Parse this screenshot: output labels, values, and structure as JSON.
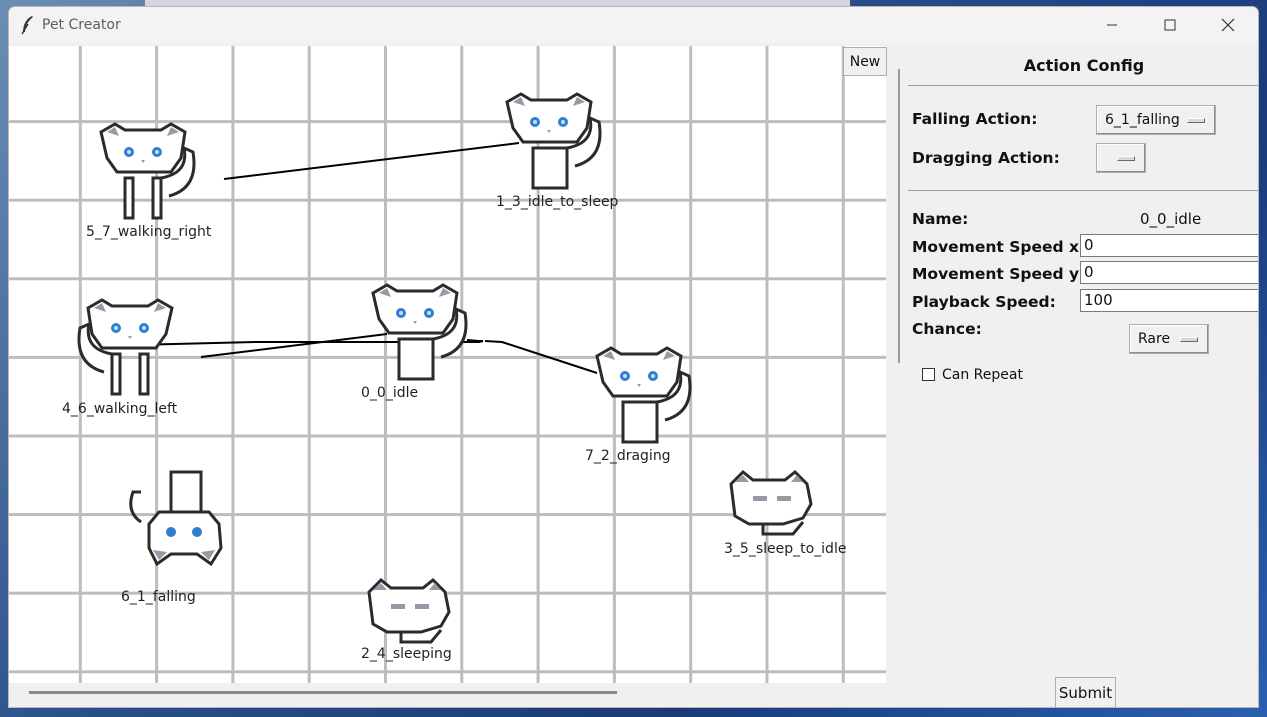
{
  "window": {
    "title": "Pet Creator"
  },
  "canvas": {
    "new_label": "New",
    "sprites": [
      {
        "id": "5_7_walking_right",
        "label": "5_7_walking_right",
        "pose": "walk-right"
      },
      {
        "id": "1_3_idle_to_sleep",
        "label": "1_3_idle_to_sleep",
        "pose": "sit"
      },
      {
        "id": "4_6_walking_left",
        "label": "4_6_walking_left",
        "pose": "walk-left"
      },
      {
        "id": "0_0_idle",
        "label": "0_0_idle",
        "pose": "sit"
      },
      {
        "id": "7_2_draging",
        "label": "7_2_draging",
        "pose": "sit"
      },
      {
        "id": "6_1_falling",
        "label": "6_1_falling",
        "pose": "fall"
      },
      {
        "id": "3_5_sleep_to_idle",
        "label": "3_5_sleep_to_idle",
        "pose": "sleep"
      },
      {
        "id": "2_4_sleeping",
        "label": "2_4_sleeping",
        "pose": "sleep"
      }
    ],
    "links": [
      {
        "from": "5_7_walking_right",
        "to": "1_3_idle_to_sleep"
      },
      {
        "from": "4_6_walking_left",
        "to": "0_0_idle"
      },
      {
        "from": "0_0_idle",
        "to": "4_6_walking_left"
      },
      {
        "from": "0_0_idle",
        "to": "7_2_draging"
      }
    ]
  },
  "panel": {
    "title": "Action Config",
    "falling_label": "Falling Action:",
    "falling_value": "6_1_falling",
    "dragging_label": "Dragging Action:",
    "dragging_value": "",
    "name_label": "Name:",
    "name_value": "0_0_idle",
    "speed_x_label": "Movement Speed x:",
    "speed_x_value": "0",
    "speed_y_label": "Movement Speed y:",
    "speed_y_value": "0",
    "playback_label": "Playback Speed:",
    "playback_value": "100",
    "chance_label": "Chance:",
    "chance_value": "Rare",
    "repeat_label": "Can Repeat",
    "repeat_checked": false,
    "submit_label": "Submit"
  },
  "colors": {
    "eye": "#2f7fd0",
    "ear": "#9a98a8",
    "outline": "#2b2b2b"
  }
}
